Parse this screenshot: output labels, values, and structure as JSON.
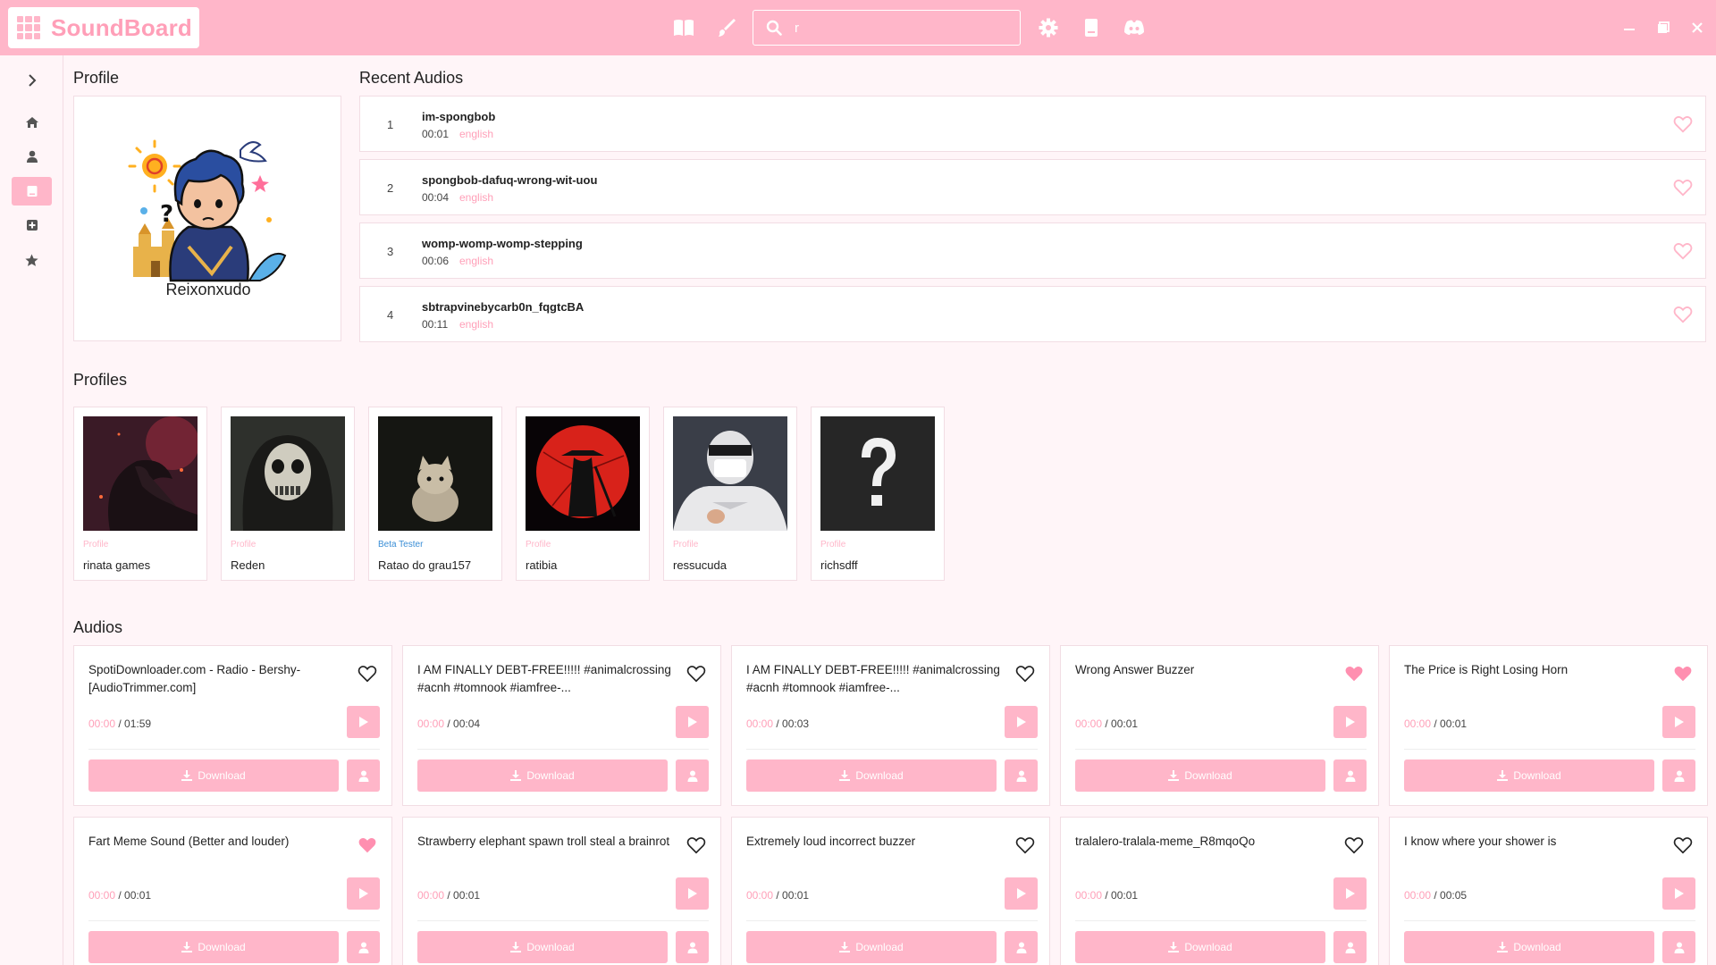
{
  "app": {
    "name": "SoundBoard",
    "search_value": "r"
  },
  "sections": {
    "profile": "Profile",
    "recent": "Recent Audios",
    "profiles": "Profiles",
    "audios": "Audios"
  },
  "profile": {
    "name": "Reixonxudo"
  },
  "recent": [
    {
      "num": "1",
      "title": "im-spongbob",
      "duration": "00:01",
      "lang": "english"
    },
    {
      "num": "2",
      "title": "spongbob-dafuq-wrong-wit-uou",
      "duration": "00:04",
      "lang": "english"
    },
    {
      "num": "3",
      "title": "womp-womp-womp-stepping",
      "duration": "00:06",
      "lang": "english"
    },
    {
      "num": "4",
      "title": "sbtrapvinebycarb0n_fqgtcBA",
      "duration": "00:11",
      "lang": "english"
    }
  ],
  "profiles": [
    {
      "role": "Profile",
      "name": "rinata games"
    },
    {
      "role": "Profile",
      "name": "Reden"
    },
    {
      "role": "Beta Tester",
      "name": "Ratao do grau157"
    },
    {
      "role": "Profile",
      "name": "ratibia"
    },
    {
      "role": "Profile",
      "name": "ressucuda"
    },
    {
      "role": "Profile",
      "name": "richsdff"
    }
  ],
  "audios": [
    {
      "title": "SpotiDownloader.com - Radio - Bershy-[AudioTrimmer.com]",
      "current": "00:00",
      "total": "/ 01:59",
      "download": "Download",
      "liked": false
    },
    {
      "title": "I AM FINALLY DEBT-FREE!!!!! #animalcrossing #acnh #tomnook #iamfree-...",
      "current": "00:00",
      "total": "/ 00:04",
      "download": "Download",
      "liked": false
    },
    {
      "title": "I AM FINALLY DEBT-FREE!!!!! #animalcrossing #acnh #tomnook #iamfree-...",
      "current": "00:00",
      "total": "/ 00:03",
      "download": "Download",
      "liked": false
    },
    {
      "title": "Wrong Answer Buzzer",
      "current": "00:00",
      "total": "/ 00:01",
      "download": "Download",
      "liked": true
    },
    {
      "title": "The Price is Right Losing Horn",
      "current": "00:00",
      "total": "/ 00:01",
      "download": "Download",
      "liked": true
    },
    {
      "title": "Fart Meme Sound (Better and louder)",
      "current": "00:00",
      "total": "/ 00:01",
      "download": "Download",
      "liked": true
    },
    {
      "title": "Strawberry elephant spawn troll steal a brainrot",
      "current": "00:00",
      "total": "/ 00:01",
      "download": "Download",
      "liked": false
    },
    {
      "title": "Extremely loud incorrect buzzer",
      "current": "00:00",
      "total": "/ 00:01",
      "download": "Download",
      "liked": false
    },
    {
      "title": "tralalero-tralala-meme_R8mqoQo",
      "current": "00:00",
      "total": "/ 00:01",
      "download": "Download",
      "liked": false
    },
    {
      "title": "I know where your shower is",
      "current": "00:00",
      "total": "/ 00:05",
      "download": "Download",
      "liked": false
    }
  ],
  "colors": {
    "accent": "#ffb6c9",
    "accent_text": "#ff9fb8",
    "beta": "#3a8ed6"
  }
}
